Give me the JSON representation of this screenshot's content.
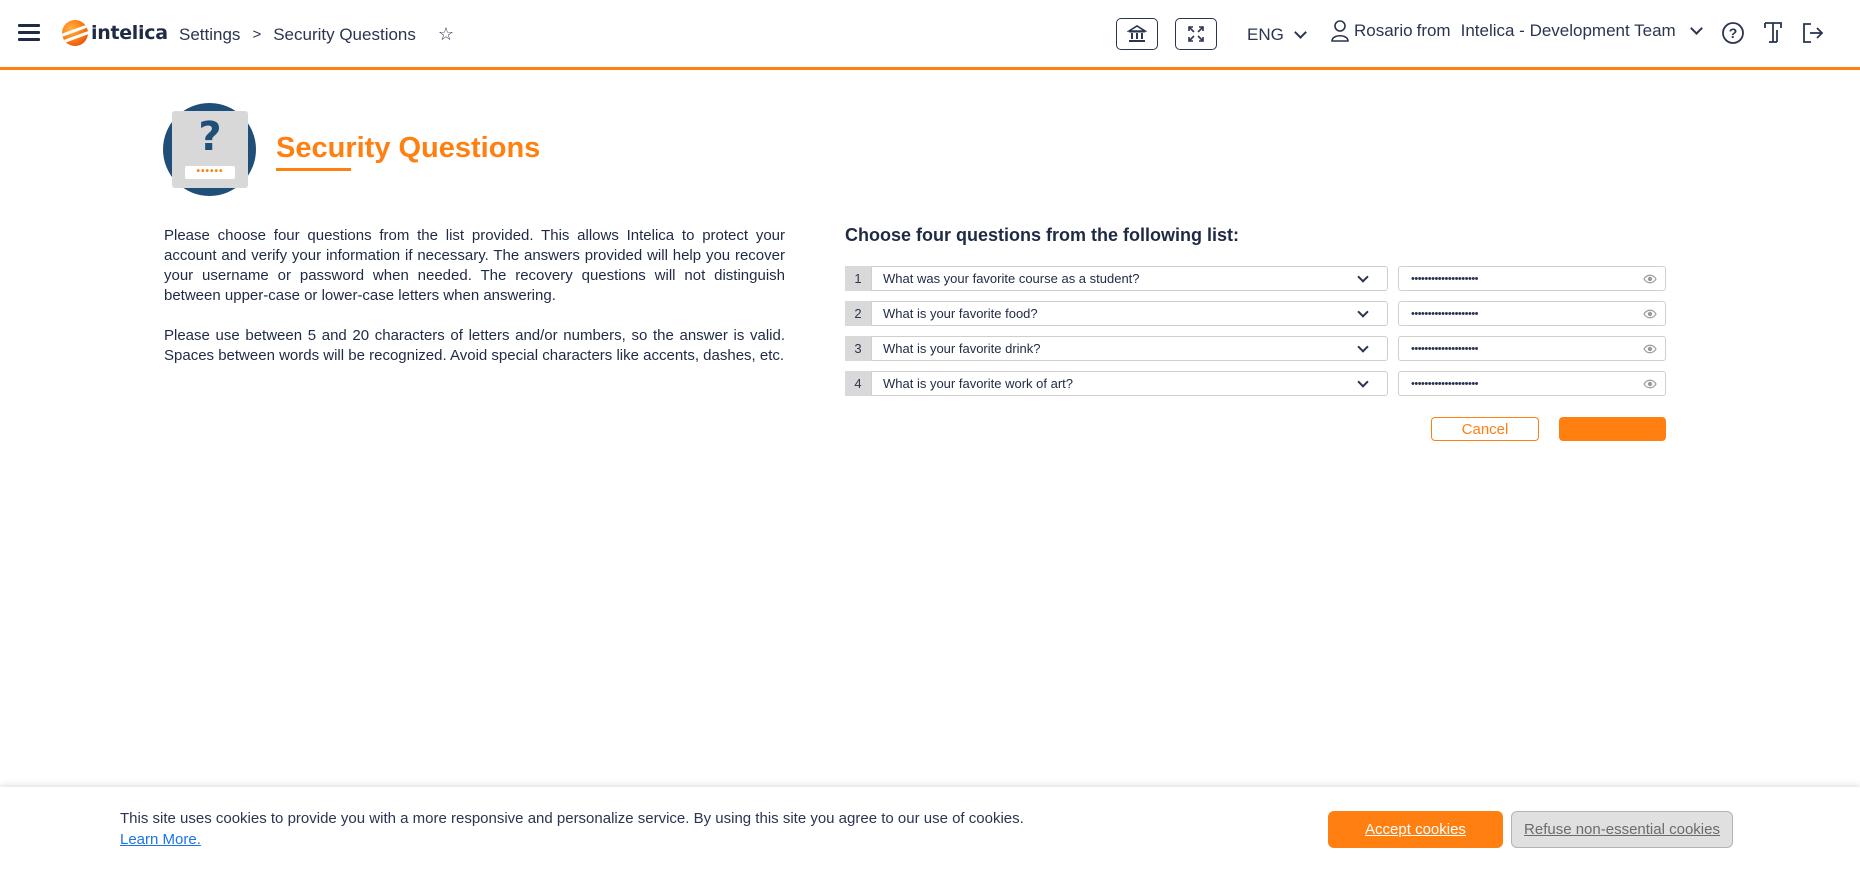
{
  "header": {
    "logo_text": "intelica",
    "breadcrumb": [
      "Settings",
      "Security Questions"
    ],
    "breadcrumb_separator": ">",
    "language": "ENG",
    "user_name": "Rosario",
    "user_from": "from",
    "team": "Intelica - Development Team",
    "accent_color": "#ff7f11"
  },
  "page": {
    "title": "Security Questions",
    "icon_text": "?",
    "icon_password_mask": "••••••",
    "intro_paragraphs": [
      "Please choose four questions from the list provided. This allows Intelica to protect your account and verify your information if necessary. The answers provided will help you recover your username or password when needed. The recovery questions will not distinguish between upper-case or lower-case letters when answering.",
      "Please use between 5 and 20 characters of letters and/or numbers, so the answer is valid. Spaces between words will be recognized. Avoid special characters like accents, dashes, etc."
    ]
  },
  "form": {
    "heading": "Choose four questions from the following list:",
    "questions": [
      {
        "number": "1",
        "question": "What was your favorite course as a student?",
        "answer_mask": "••••••••••••••••••••"
      },
      {
        "number": "2",
        "question": "What is your favorite food?",
        "answer_mask": "••••••••••••••••••••"
      },
      {
        "number": "3",
        "question": "What is your favorite drink?",
        "answer_mask": "••••••••••••••••••••"
      },
      {
        "number": "4",
        "question": "What is your favorite work of art?",
        "answer_mask": "••••••••••••••••••••"
      }
    ],
    "cancel_label": "Cancel",
    "save_label": ""
  },
  "cookie": {
    "message": "This site uses cookies to provide you with a more responsive and personalize service. By using this site you agree to our use of cookies.",
    "learn_more": "Learn More.",
    "accept_label": "Accept cookies",
    "refuse_label": "Refuse non-essential cookies"
  }
}
